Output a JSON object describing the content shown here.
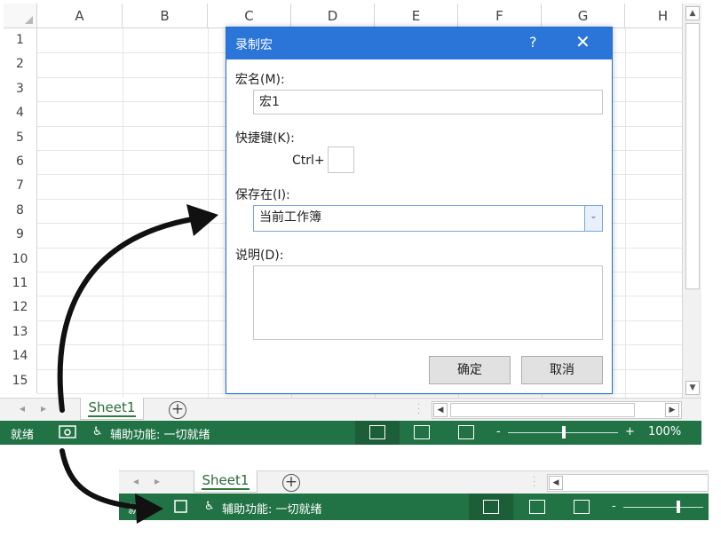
{
  "sheet": {
    "columns": [
      "A",
      "B",
      "C",
      "D",
      "E",
      "F",
      "G",
      "H"
    ],
    "rows": [
      "1",
      "2",
      "3",
      "4",
      "5",
      "6",
      "7",
      "8",
      "9",
      "10",
      "11",
      "12",
      "13",
      "14",
      "15"
    ]
  },
  "dialog": {
    "title": "录制宏",
    "help": "?",
    "close": "✕",
    "macro_name_label": "宏名(M):",
    "macro_name_value": "宏1",
    "shortcut_label": "快捷键(K):",
    "shortcut_prefix": "Ctrl+",
    "shortcut_value": "",
    "store_in_label": "保存在(I):",
    "store_in_value": "当前工作簿",
    "description_label": "说明(D):",
    "description_value": "",
    "ok": "确定",
    "cancel": "取消"
  },
  "tabs": {
    "sheet_name": "Sheet1",
    "add": "+"
  },
  "status": {
    "ready": "就绪",
    "accessibility": "辅助功能: 一切就绪",
    "zoom_minus": "-",
    "zoom_plus": "+",
    "zoom_level": "100%"
  },
  "colors": {
    "excel_green": "#217346",
    "dialog_blue": "#2b74d8"
  }
}
